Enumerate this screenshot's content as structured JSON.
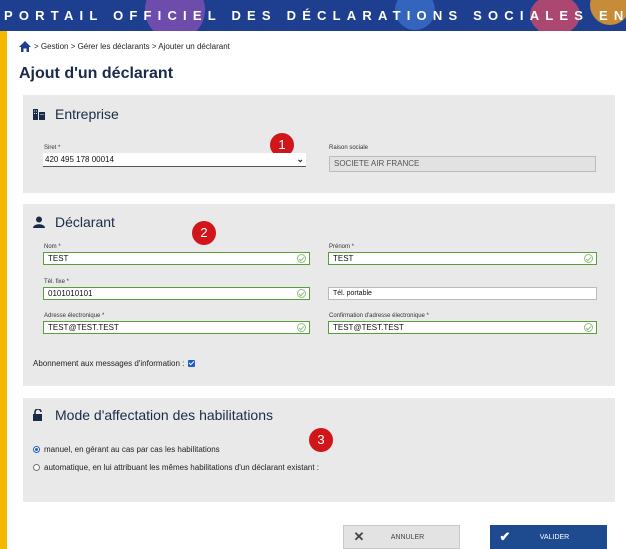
{
  "banner": {
    "title": "PORTAIL OFFICIEL DES DÉCLARATIONS SOCIALES EN LIGNE"
  },
  "breadcrumb": {
    "home_icon": "home-icon",
    "path": "> Gestion > Gérer les déclarants > Ajouter un déclarant"
  },
  "page": {
    "title": "Ajout d'un déclarant"
  },
  "entreprise": {
    "title": "Entreprise",
    "icon": "building-icon",
    "siret_label": "Siret *",
    "siret_value": "420 495 178 00014",
    "raison_label": "Raison sociale",
    "raison_value": "SOCIETE AIR FRANCE",
    "marker": "1"
  },
  "declarant": {
    "title": "Déclarant",
    "icon": "user-icon",
    "marker": "2",
    "nom_label": "Nom *",
    "nom_value": "TEST",
    "prenom_label": "Prénom *",
    "prenom_value": "TEST",
    "tel_fixe_label": "Tél. fixe *",
    "tel_fixe_value": "0101010101",
    "tel_portable_placeholder": "Tél. portable",
    "email_label": "Adresse électronique *",
    "email_value": "TEST@TEST.TEST",
    "email_confirm_label": "Confirmation d'adresse électronique *",
    "email_confirm_value": "TEST@TEST.TEST",
    "subscribe_label": "Abonnement aux messages d'information :"
  },
  "habilitations": {
    "title": "Mode d'affectation des habilitations",
    "icon": "unlock-icon",
    "marker": "3",
    "option_manual": "manuel, en gérant au cas par cas les habilitations",
    "option_auto": "automatique, en lui attribuant les mêmes habilitations d'un déclarant existant :"
  },
  "buttons": {
    "cancel": "ANNULER",
    "validate": "VALIDER"
  },
  "colors": {
    "banner": "#1e3f8f",
    "marker": "#d0161a",
    "valid_border": "#5a9e3a",
    "primary": "#1e4a8f"
  }
}
